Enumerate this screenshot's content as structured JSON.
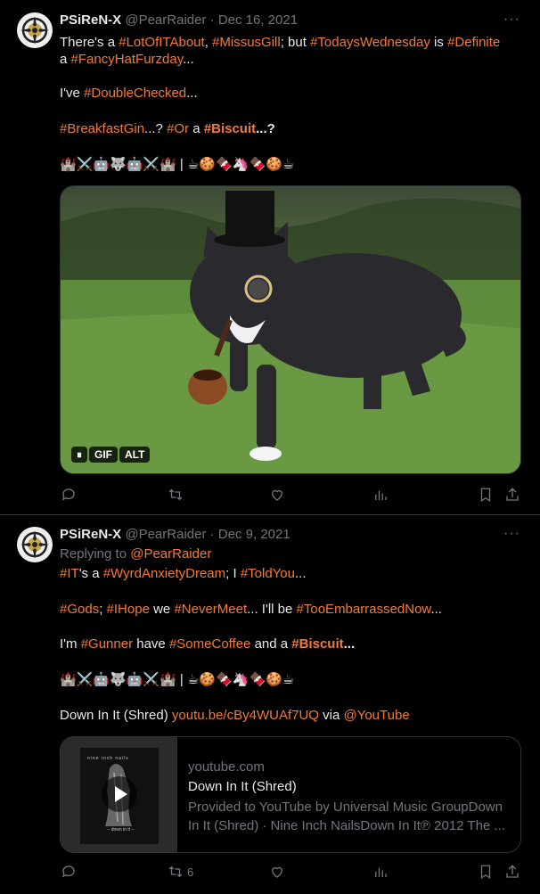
{
  "tweets": [
    {
      "author_name": "PSiReN-X",
      "handle": "@PearRaider",
      "separator": "·",
      "date": "Dec 16, 2021",
      "more": "···",
      "text_lines": {
        "l1": {
          "a": "There's a ",
          "b": "#LotOfITAbout",
          "c": ", ",
          "d": "#MissusGill",
          "e": "; but ",
          "f": "#TodaysWednesday",
          "g": " is ",
          "h": "#Definite"
        },
        "l2": {
          "a": "a ",
          "b": "#FancyHatFurzday",
          "c": "..."
        },
        "l3": {
          "a": "I've ",
          "b": "#DoubleChecked",
          "c": "..."
        },
        "l4": {
          "a": "#BreakfastGin",
          "b": "...? ",
          "c": "#Or",
          "d": " a ",
          "e": "#Biscuit",
          "f": "...?"
        }
      },
      "emoji_line": "🏰⚔️🤖🐺🤖⚔️🏰 | ☕🍪🍫🦄🍫🍪☕",
      "media": {
        "badges": [
          "⏸",
          "GIF",
          "ALT"
        ],
        "watermark": "GIF"
      },
      "actions": {
        "reply": "",
        "retweet": "",
        "like": "",
        "views": ""
      }
    },
    {
      "author_name": "PSiReN-X",
      "handle": "@PearRaider",
      "separator": "·",
      "date": "Dec 9, 2021",
      "more": "···",
      "replying_prefix": "Replying to ",
      "replying_to": "@PearRaider",
      "text_lines": {
        "l1": {
          "a": "#IT",
          "b": "'s a ",
          "c": "#WyrdAnxietyDream",
          "d": "; I ",
          "e": "#ToldYou",
          "f": "..."
        },
        "l2": {
          "a": "#Gods",
          "b": "; ",
          "c": "#IHope",
          "d": " we ",
          "e": "#NeverMeet",
          "f": "... I'll be ",
          "g": "#TooEmbarrassedNow",
          "h": "..."
        },
        "l3": {
          "a": "I'm ",
          "b": "#Gunner",
          "c": " have ",
          "d": "#SomeCoffee",
          "e": " and a ",
          "f": "#Biscuit",
          "g": "..."
        },
        "l4": {
          "a": "Down In It (Shred) ",
          "b": "youtu.be/cBy4WUAf7UQ",
          "c": " via ",
          "d": "@YouTube"
        }
      },
      "emoji_line": "🏰⚔️🤖🐺🤖⚔️🏰 | ☕🍪🍫🦄🍫🍪☕",
      "card": {
        "domain": "youtube.com",
        "title": "Down In It (Shred)",
        "description": "Provided to YouTube by Universal Music GroupDown In It (Shred) · Nine Inch NailsDown In It℗ 2012 The ...",
        "thumb_top": "nine inch nails",
        "thumb_bottom": "-- down in it --"
      },
      "actions": {
        "reply": "",
        "retweet": "6",
        "like": "",
        "views": ""
      }
    }
  ],
  "colors": {
    "hashtag": "#f47a35",
    "muted": "#71767b",
    "text": "#e7e9ea",
    "background": "#000000"
  }
}
